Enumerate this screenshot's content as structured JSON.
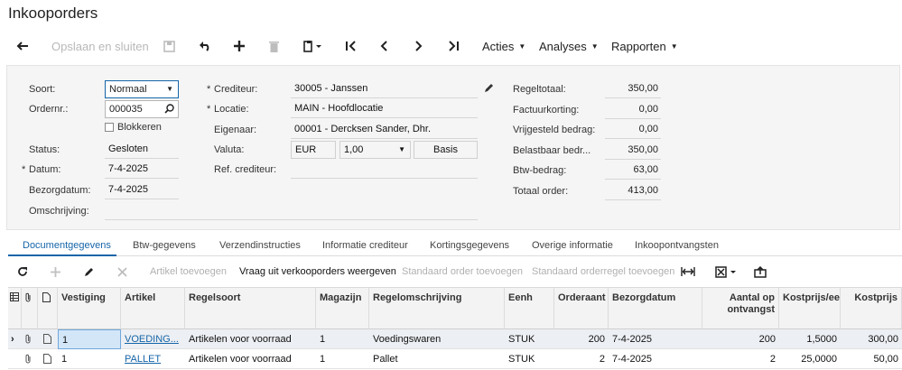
{
  "title": "Inkooporders",
  "toolbar": {
    "save_close": "Opslaan en sluiten",
    "actions": "Acties",
    "analyses": "Analyses",
    "reports": "Rapporten"
  },
  "form": {
    "type_label": "Soort:",
    "type_value": "Normaal",
    "ordernr_label": "Ordernr.:",
    "ordernr_value": "000035",
    "blocked_label": "Blokkeren",
    "status_label": "Status:",
    "status_value": "Gesloten",
    "date_label": "Datum:",
    "date_value": "7-4-2025",
    "delivery_label": "Bezorgdatum:",
    "delivery_value": "7-4-2025",
    "description_label": "Omschrijving:",
    "creditor_label": "Crediteur:",
    "creditor_value": "30005 - Janssen",
    "location_label": "Locatie:",
    "location_value": "MAIN - Hoofdlocatie",
    "owner_label": "Eigenaar:",
    "owner_value": "00001 - Dercksen Sander, Dhr.",
    "currency_label": "Valuta:",
    "currency_value": "EUR",
    "rate_value": "1,00",
    "basis_label": "Basis",
    "ref_label": "Ref. crediteur:"
  },
  "totals": [
    {
      "label": "Regeltotaal:",
      "value": "350,00"
    },
    {
      "label": "Factuurkorting:",
      "value": "0,00"
    },
    {
      "label": "Vrijgesteld bedrag:",
      "value": "0,00"
    },
    {
      "label": "Belastbaar bedr...",
      "value": "350,00"
    },
    {
      "label": "Btw-bedrag:",
      "value": "63,00"
    },
    {
      "label": "Totaal order:",
      "value": "413,00"
    }
  ],
  "tabs": [
    "Documentgegevens",
    "Btw-gegevens",
    "Verzendinstructies",
    "Informatie crediteur",
    "Kortingsgegevens",
    "Overige informatie",
    "Inkoopontvangsten"
  ],
  "grid_toolbar": {
    "add_item": "Artikel toevoegen",
    "request_orders": "Vraag uit verkooporders weergeven",
    "add_standard_order": "Standaard order toevoegen",
    "add_standard_line": "Standaard orderregel toevoegen"
  },
  "columns": [
    "Vestiging",
    "Artikel",
    "Regelsoort",
    "Magazijn",
    "Regelomschrijving",
    "Eenh",
    "Orderaant",
    "Bezorgdatum",
    "Aantal op ontvangst",
    "Kostprijs/eenh",
    "Kostprijs"
  ],
  "rows": [
    {
      "vestiging": "1",
      "artikel": "VOEDING...",
      "regelsoort": "Artikelen voor voorraad",
      "magazijn": "1",
      "omschrijving": "Voedingswaren",
      "eenh": "STUK",
      "orderaant": "200",
      "bezorgdatum": "7-4-2025",
      "ontvangst": "200",
      "kostprijs_eenh": "1,5000",
      "kostprijs": "300,00"
    },
    {
      "vestiging": "1",
      "artikel": "PALLET",
      "regelsoort": "Artikelen voor voorraad",
      "magazijn": "1",
      "omschrijving": "Pallet",
      "eenh": "STUK",
      "orderaant": "2",
      "bezorgdatum": "7-4-2025",
      "ontvangst": "2",
      "kostprijs_eenh": "25,0000",
      "kostprijs": "50,00"
    }
  ]
}
